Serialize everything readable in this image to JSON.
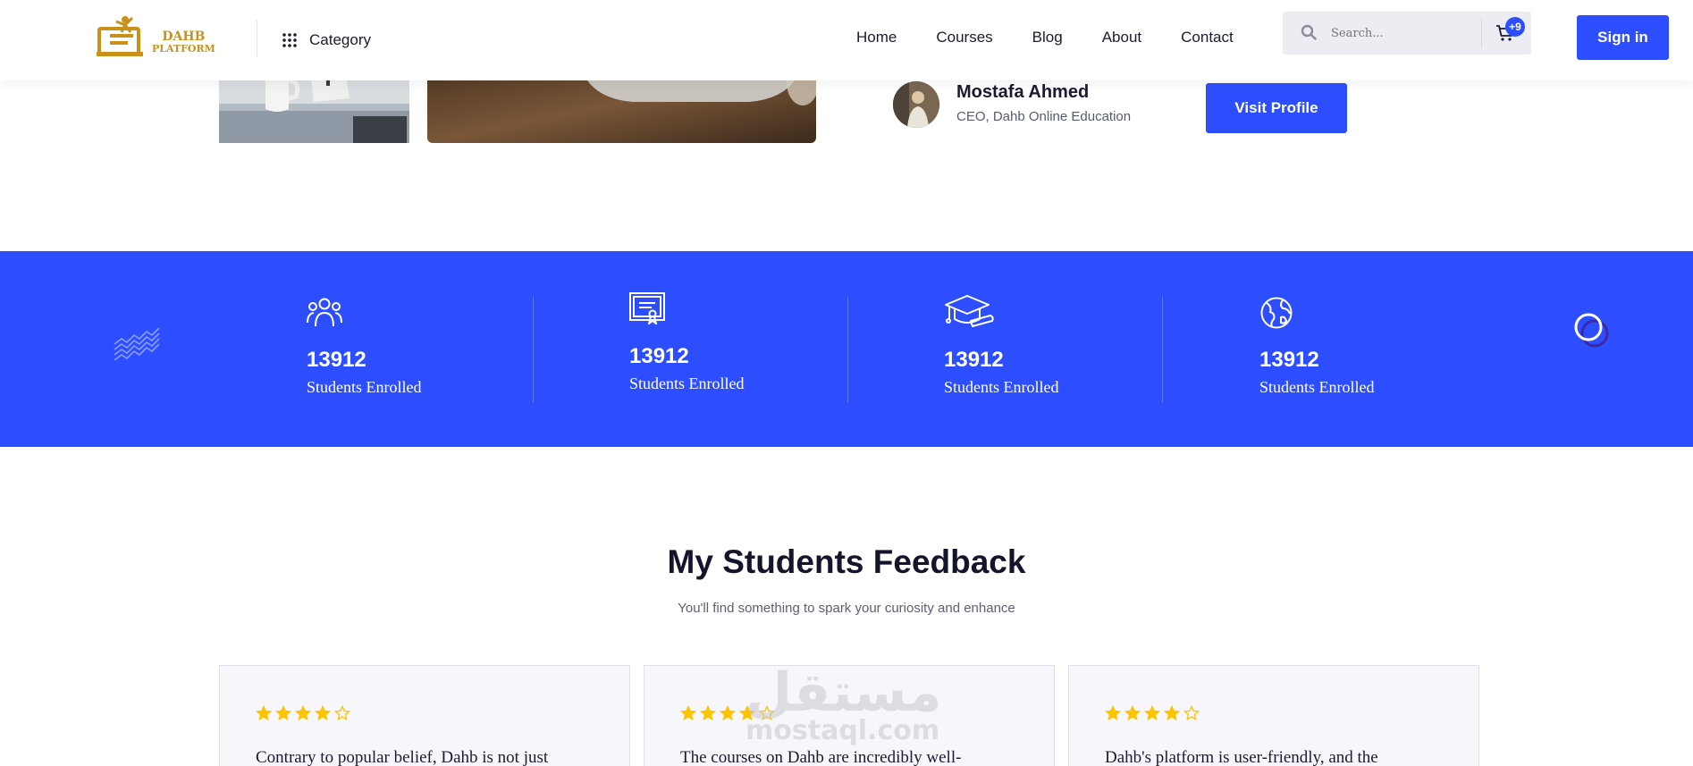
{
  "header": {
    "logo": {
      "line1": "DAHB",
      "line2": "PLATFORM"
    },
    "category_label": "Category",
    "nav": [
      "Home",
      "Courses",
      "Blog",
      "About",
      "Contact"
    ],
    "search_placeholder": "Search...",
    "cart_badge": "+9",
    "signin_label": "Sign in"
  },
  "author": {
    "name": "Mostafa Ahmed",
    "role": "CEO, Dahb Online Education",
    "visit_label": "Visit Profile"
  },
  "stats": [
    {
      "icon": "users-icon",
      "value": "13912",
      "label": "Students Enrolled"
    },
    {
      "icon": "certificate-icon",
      "value": "13912",
      "label": "Students Enrolled"
    },
    {
      "icon": "graduation-cap-icon",
      "value": "13912",
      "label": "Students Enrolled"
    },
    {
      "icon": "globe-icon",
      "value": "13912",
      "label": "Students Enrolled"
    }
  ],
  "feedback": {
    "title": "My Students Feedback",
    "subtitle": "You'll find something to spark your curiosity and enhance",
    "cards": [
      {
        "rating": 4,
        "text": "Contrary to popular belief, Dahb is not just"
      },
      {
        "rating": 4,
        "text": "The courses on Dahb are incredibly well-"
      },
      {
        "rating": 4,
        "text": "Dahb's platform is user-friendly, and the"
      }
    ]
  },
  "watermark": {
    "arabic": "مستقل",
    "latin": "mostaql.com"
  },
  "colors": {
    "primary": "#2d4eff",
    "star": "#ffc400",
    "logo": "#c9911a",
    "heading": "#14142b"
  }
}
